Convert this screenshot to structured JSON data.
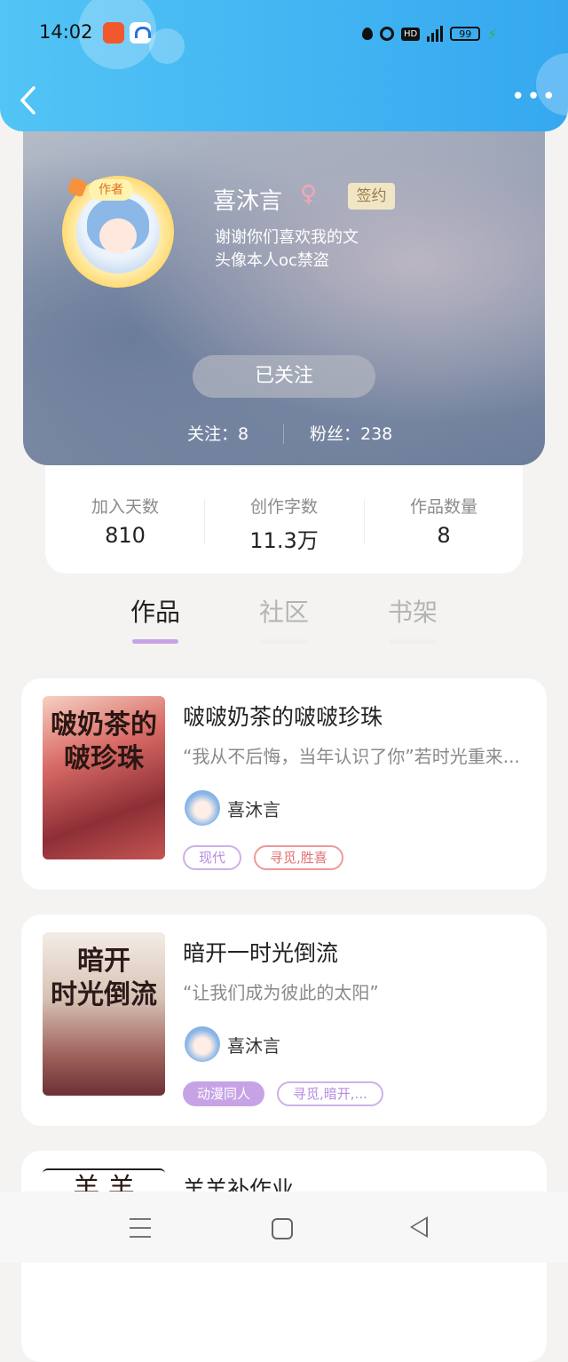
{
  "status_bar": {
    "time": "14:02",
    "icons": [
      "pinduoduo-app-icon",
      "baidu-netdisk-icon",
      "water-drop-icon",
      "alarm-icon",
      "hd-icon",
      "5g-signal-icon",
      "battery-icon",
      "charging-icon"
    ],
    "hd": "HD",
    "battery": "99"
  },
  "header": {
    "back_icon": "back-arrow-icon",
    "more_icon": "more-icon"
  },
  "profile": {
    "name": "喜沐言",
    "gender_symbol": "♀",
    "signed_badge": "签约",
    "author_badge": "作者",
    "bio_line1": "谢谢你们喜欢我的文",
    "bio_line2": "头像本人oc禁盗",
    "follow_button": "已关注",
    "following": "关注：8",
    "fans": "粉丝：238"
  },
  "stats": [
    {
      "label": "加入天数",
      "value": "810"
    },
    {
      "label": "创作字数",
      "value": "11.3万"
    },
    {
      "label": "作品数量",
      "value": "8"
    }
  ],
  "tabs": [
    {
      "label": "作品",
      "active": true
    },
    {
      "label": "社区",
      "active": false
    },
    {
      "label": "书架",
      "active": false
    }
  ],
  "works": [
    {
      "title": "啵啵奶茶的啵啵珍珠",
      "description": "“我从不后悔，当年认识了你”若时光重来...",
      "cover_text": "啵奶茶的\n啵珍珠",
      "author": "喜沐言",
      "tags": [
        {
          "label": "现代",
          "style": "purple-outline"
        },
        {
          "label": "寻觅,胜喜",
          "style": "red-outline"
        }
      ]
    },
    {
      "title": "暗开一时光倒流",
      "description": "“让我们成为彼此的太阳”",
      "cover_text": "暗开\n时光倒流",
      "author": "喜沐言",
      "tags": [
        {
          "label": "动漫同人",
          "style": "purple-fill"
        },
        {
          "label": "寻觅,暗开,...",
          "style": "purple-outline"
        }
      ]
    },
    {
      "title": "羊羊补作业",
      "cover_text": "羊 羊"
    }
  ],
  "colors": {
    "header_blue": "#3cb2f2",
    "accent_purple": "#c7a3e6",
    "tag_red": "#e37070"
  },
  "navbar": {
    "icons": [
      "menu-icon",
      "home-icon",
      "back-icon"
    ]
  }
}
